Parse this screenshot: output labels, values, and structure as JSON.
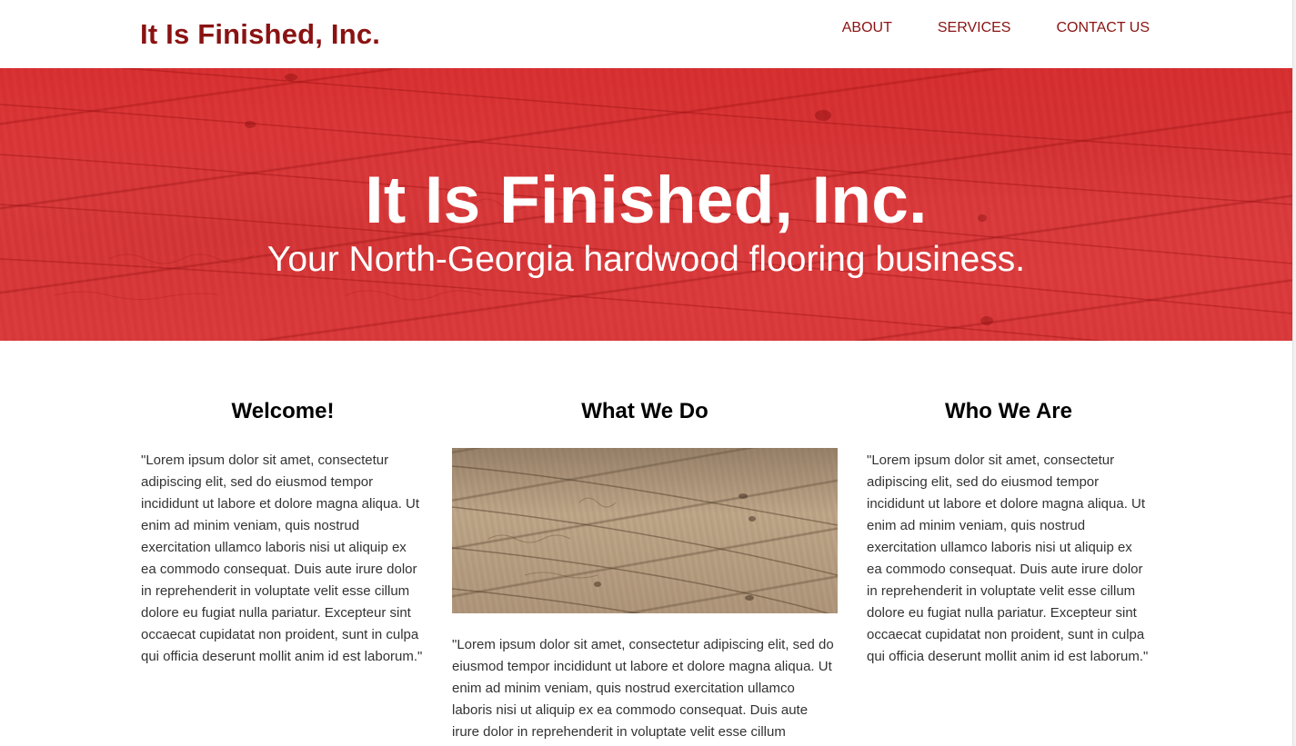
{
  "header": {
    "brand": "It Is Finished, Inc.",
    "nav": {
      "about": "ABOUT",
      "services": "SERVICES",
      "contact": "CONTACT US"
    }
  },
  "hero": {
    "title": "It Is Finished, Inc.",
    "subtitle": "Your North-Georgia hardwood flooring business."
  },
  "columns": {
    "welcome": {
      "heading": "Welcome!",
      "body": "\"Lorem ipsum dolor sit amet, consectetur adipiscing elit, sed do eiusmod tempor incididunt ut labore et dolore magna aliqua. Ut enim ad minim veniam, quis nostrud exercitation ullamco laboris nisi ut aliquip ex ea commodo consequat. Duis aute irure dolor in reprehenderit in voluptate velit esse cillum dolore eu fugiat nulla pariatur. Excepteur sint occaecat cupidatat non proident, sunt in culpa qui officia deserunt mollit anim id est laborum.\""
    },
    "what_we_do": {
      "heading": "What We Do",
      "body": "\"Lorem ipsum dolor sit amet, consectetur adipiscing elit, sed do eiusmod tempor incididunt ut labore et dolore magna aliqua. Ut enim ad minim veniam, quis nostrud exercitation ullamco laboris nisi ut aliquip ex ea commodo consequat. Duis aute irure dolor in reprehenderit in voluptate velit esse cillum"
    },
    "who_we_are": {
      "heading": "Who We Are",
      "body": "\"Lorem ipsum dolor sit amet, consectetur adipiscing elit, sed do eiusmod tempor incididunt ut labore et dolore magna aliqua. Ut enim ad minim veniam, quis nostrud exercitation ullamco laboris nisi ut aliquip ex ea commodo consequat. Duis aute irure dolor in reprehenderit in voluptate velit esse cillum dolore eu fugiat nulla pariatur. Excepteur sint occaecat cupidatat non proident, sunt in culpa qui officia deserunt mollit anim id est laborum.\""
    }
  },
  "colors": {
    "brand": "#8b1212",
    "hero": "#d9383a",
    "heading": "#000000",
    "body_text": "#333333"
  }
}
